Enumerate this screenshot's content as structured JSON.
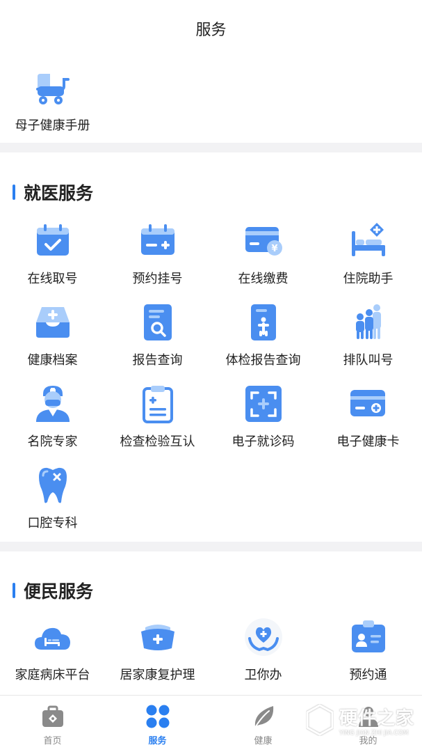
{
  "header": {
    "title": "服务"
  },
  "top_section": {
    "items": [
      {
        "label": "母子健康手册",
        "icon": "baby-stroller-icon"
      }
    ]
  },
  "medical_section": {
    "title": "就医服务",
    "items": [
      {
        "label": "在线取号",
        "icon": "calendar-check-icon"
      },
      {
        "label": "预约挂号",
        "icon": "calendar-plus-icon"
      },
      {
        "label": "在线缴费",
        "icon": "card-yuan-icon"
      },
      {
        "label": "住院助手",
        "icon": "hospital-bed-icon"
      },
      {
        "label": "健康档案",
        "icon": "inbox-plus-icon"
      },
      {
        "label": "报告查询",
        "icon": "report-search-icon"
      },
      {
        "label": "体检报告查询",
        "icon": "checkup-report-icon"
      },
      {
        "label": "排队叫号",
        "icon": "queue-people-icon"
      },
      {
        "label": "名院专家",
        "icon": "doctor-icon"
      },
      {
        "label": "检查检验互认",
        "icon": "clipboard-icon"
      },
      {
        "label": "电子就诊码",
        "icon": "scan-code-icon"
      },
      {
        "label": "电子健康卡",
        "icon": "health-card-icon"
      },
      {
        "label": "口腔专科",
        "icon": "tooth-icon"
      }
    ]
  },
  "convenience_section": {
    "title": "便民服务",
    "items": [
      {
        "label": "家庭病床平台",
        "icon": "cloud-bed-icon"
      },
      {
        "label": "居家康复护理",
        "icon": "nurse-cap-icon"
      },
      {
        "label": "卫你办",
        "icon": "heart-hands-icon"
      },
      {
        "label": "预约通",
        "icon": "id-badge-icon"
      }
    ]
  },
  "tabbar": {
    "tabs": [
      {
        "label": "首页",
        "icon": "medical-kit-icon",
        "active": false
      },
      {
        "label": "服务",
        "icon": "grid-icon",
        "active": true
      },
      {
        "label": "健康",
        "icon": "leaf-icon",
        "active": false
      },
      {
        "label": "我的",
        "icon": "user-icon",
        "active": false
      }
    ]
  },
  "watermark": {
    "main": "硬件之家",
    "sub": "YING JIAN ZHI JIA.COM"
  },
  "colors": {
    "accent": "#2a7ff0",
    "icon_blue": "#4a8ef0",
    "icon_light": "#a9cdfb",
    "divider": "#f2f2f4"
  }
}
